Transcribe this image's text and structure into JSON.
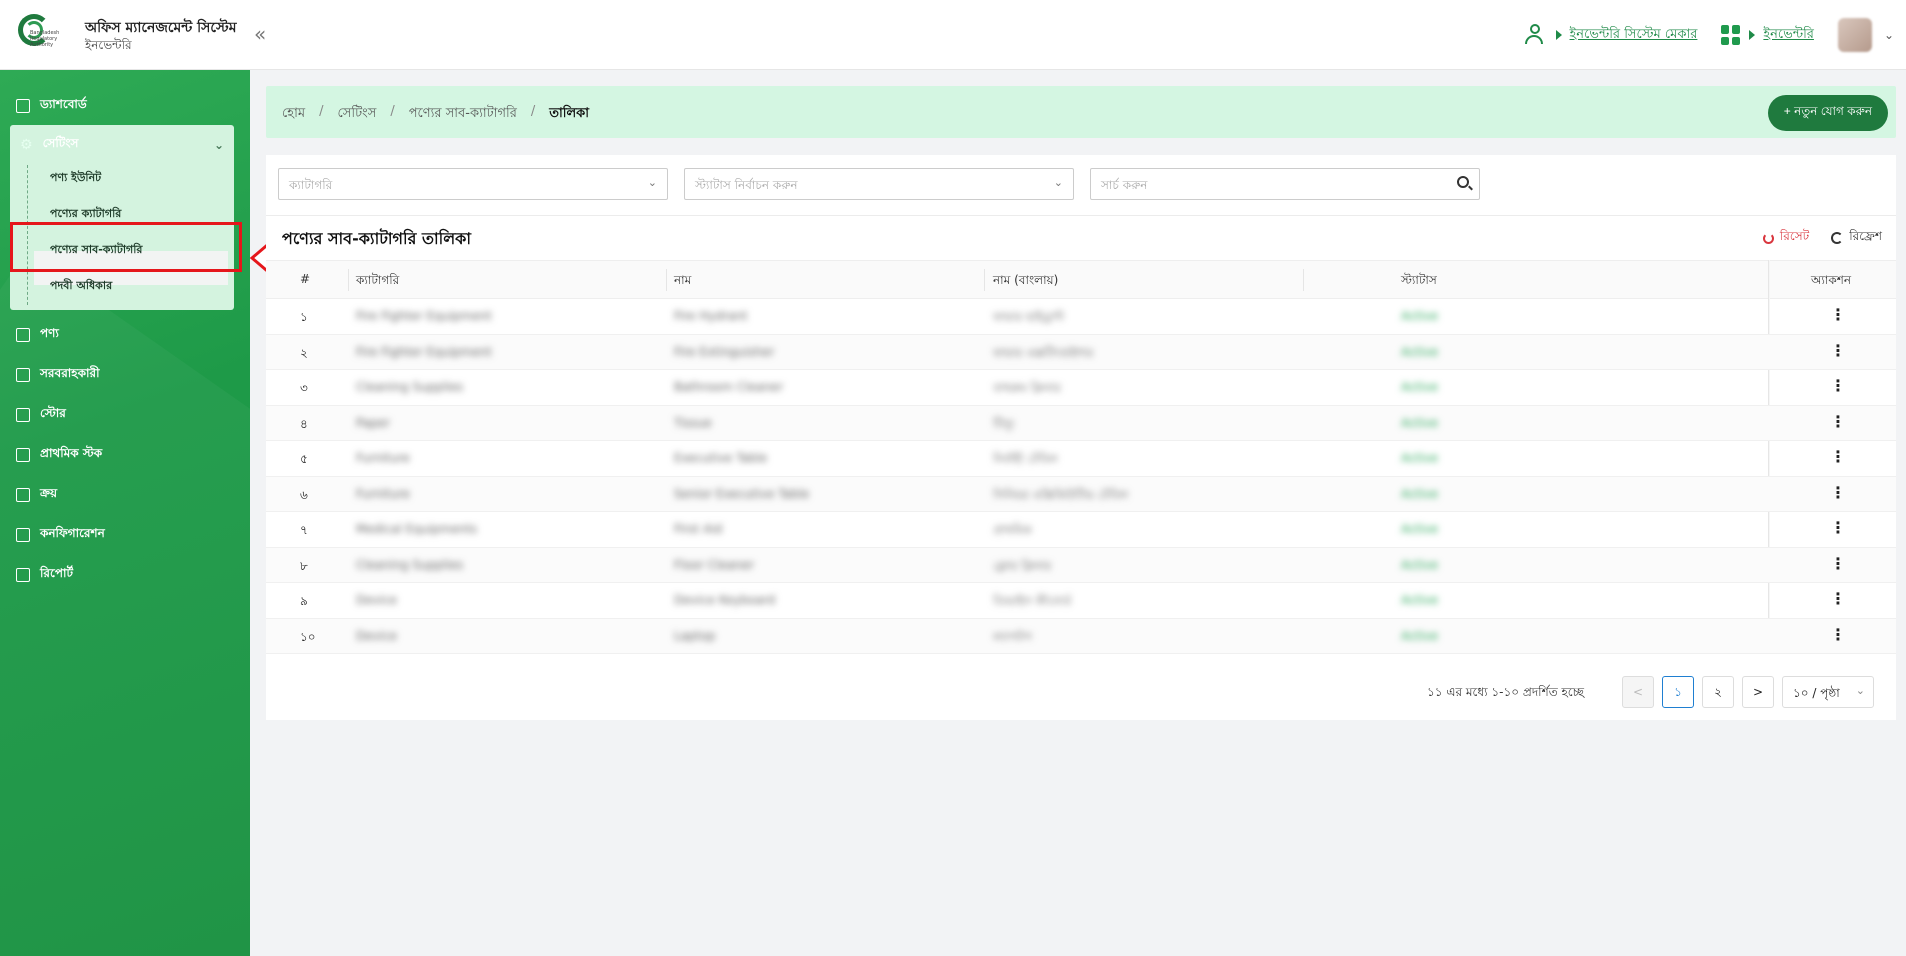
{
  "header": {
    "logo_text": "Bangladesh Regulatory Authority",
    "app_title": "অফিস ম্যানেজমেন্ট সিস্টেম",
    "app_subtitle": "ইনভেন্টরি",
    "collapse_label": "«",
    "maker_link": "ইনভেন্টরি সিস্টেম মেকার",
    "module_link": "ইনভেন্টরি"
  },
  "sidebar": {
    "items": [
      {
        "label": "ড্যাশবোর্ড"
      },
      {
        "label": "পণ্য"
      },
      {
        "label": "সরবরাহকারী"
      },
      {
        "label": "স্টোর"
      },
      {
        "label": "প্রাথমিক স্টক"
      },
      {
        "label": "ক্রয়"
      },
      {
        "label": "কনফিগারেশন"
      },
      {
        "label": "রিপোর্ট"
      }
    ],
    "settings": {
      "label": "সেটিংস",
      "sub_items": [
        {
          "label": "পণ্য ইউনিট"
        },
        {
          "label": "পণ্যের ক্যাটাগরি"
        },
        {
          "label": "পণ্যের সাব-ক্যাটাগরি"
        },
        {
          "label": "পদবী অধিকার"
        }
      ]
    }
  },
  "breadcrumb": {
    "items": [
      "হোম",
      "সেটিংস",
      "পণ্যের সাব-ক্যাটাগরি",
      "তালিকা"
    ],
    "sep": "/"
  },
  "add_button": "+ নতুন যোগ করুন",
  "filters": {
    "category_placeholder": "ক্যাটাগরি",
    "status_placeholder": "স্ট্যাটাস নির্বাচন করুন",
    "search_placeholder": "সার্চ করুন"
  },
  "table": {
    "title": "পণ্যের সাব-ক্যাটাগরি তালিকা",
    "reset_label": "রিসেট",
    "refresh_label": "রিফ্রেশ",
    "columns": [
      "#",
      "ক্যাটাগরি",
      "নাম",
      "নাম (বাংলায়)",
      "স্ট্যাটাস",
      "অ্যাকশন"
    ],
    "rows": [
      {
        "no": "১",
        "category": "Fire Fighter Equipment",
        "name": "Fire Hydrant",
        "name_bn": "ফায়ার হাইড্রান্ট",
        "status": "Active"
      },
      {
        "no": "২",
        "category": "Fire Fighter Equipment",
        "name": "Fire Extinguisher",
        "name_bn": "ফায়ার এক্সটিংগুইশার",
        "status": "Active"
      },
      {
        "no": "৩",
        "category": "Cleaning Supplies",
        "name": "Bathroom Cleaner",
        "name_bn": "বাথরুম ক্লিনার",
        "status": "Active"
      },
      {
        "no": "৪",
        "category": "Paper",
        "name": "Tissue",
        "name_bn": "টিস্যু",
        "status": "Active"
      },
      {
        "no": "৫",
        "category": "Furniture",
        "name": "Executive Table",
        "name_bn": "নির্বাহী টেবিল",
        "status": "Active"
      },
      {
        "no": "৬",
        "category": "Furniture",
        "name": "Senior Executive Table",
        "name_bn": "সিনিয়র এক্সিকিউটিভ টেবিল",
        "status": "Active"
      },
      {
        "no": "৭",
        "category": "Medical Equipments",
        "name": "First Aid",
        "name_bn": "প্রাথমিক",
        "status": "Active"
      },
      {
        "no": "৮",
        "category": "Cleaning Supplies",
        "name": "Floor Cleaner",
        "name_bn": "ফ্লোর ক্লিনার",
        "status": "Active"
      },
      {
        "no": "৯",
        "category": "Device",
        "name": "Device Keyboard",
        "name_bn": "ডিভাইস কীবোর্ড",
        "status": "Active"
      },
      {
        "no": "১০",
        "category": "Device",
        "name": "Laptop",
        "name_bn": "ল্যাপটপ",
        "status": "Active"
      }
    ]
  },
  "pagination": {
    "info": "১১ এর মধ্যে ১-১০ প্রদর্শিত হচ্ছে",
    "prev": "<",
    "pages": [
      "১",
      "২"
    ],
    "next": ">",
    "page_size": "১০ / পৃষ্ঠা"
  },
  "colors": {
    "brand_green": "#1f7a3e",
    "sidebar_green": "#1e9a48",
    "highlight_red": "#e5161b",
    "crumb_bg": "#d4f6e2"
  }
}
